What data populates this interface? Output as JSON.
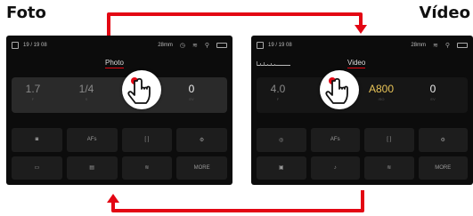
{
  "titles": {
    "left": "Foto",
    "right": "Vídeo"
  },
  "colors": {
    "arrow": "#e30613",
    "screen": "#0c0c0c",
    "accent_red": "#e30613",
    "iso_gold": "#e8c458"
  },
  "photo_screen": {
    "status": {
      "sd_icon": "sd-card-icon",
      "storage": "19 / 19 08",
      "focal": "28mm",
      "icons": [
        "timer-icon",
        "wifi-icon",
        "gps-icon"
      ],
      "battery_icon": "battery-icon"
    },
    "mode_active": "Photo",
    "mode_inactive": "",
    "exposure": [
      {
        "value": "1.7",
        "sub": "F"
      },
      {
        "value": "1/4",
        "sub": "S"
      },
      {
        "value": "",
        "sub": ""
      },
      {
        "value": "0",
        "sub": "EV"
      }
    ],
    "buttons": [
      "camera-icon",
      "AFs",
      "[ ]",
      "settings-icon",
      "frame-icon",
      "stack-icon",
      "wifi-icon",
      "MORE"
    ]
  },
  "video_screen": {
    "status": {
      "sd_icon": "sd-card-icon",
      "storage": "19 / 19 08",
      "focal": "28mm",
      "icons": [
        "wifi-icon",
        "gps-icon"
      ],
      "battery_icon": "battery-icon"
    },
    "mode_inactive": "",
    "mode_active": "Video",
    "exposure": [
      {
        "value": "4.0",
        "sub": "F"
      },
      {
        "value": "",
        "sub": ""
      },
      {
        "value": "A800",
        "sub": "ISO"
      },
      {
        "value": "0",
        "sub": "EV"
      }
    ],
    "buttons": [
      "aperture-icon",
      "AFs",
      "[ ]",
      "settings-icon",
      "frame-icon",
      "mic-icon",
      "wifi-icon",
      "MORE"
    ]
  }
}
